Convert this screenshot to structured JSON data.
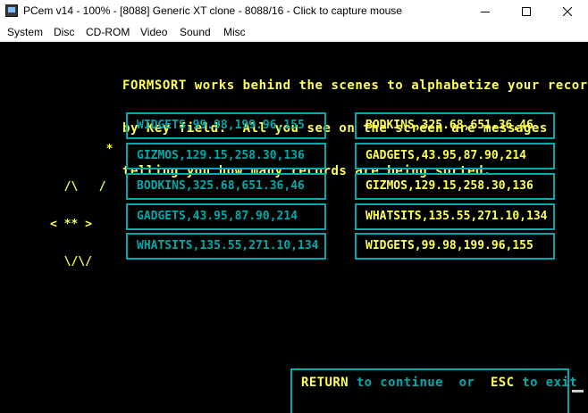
{
  "window": {
    "title": "PCem v14 - 100% - [8088] Generic XT clone - 8088/16 - Click to capture mouse",
    "icon": "pcem-app-icon",
    "controls": [
      "minimize-icon",
      "maximize-icon",
      "close-icon"
    ]
  },
  "menu": [
    "System",
    "Disc",
    "CD-ROM",
    "Video",
    "Sound",
    "Misc"
  ],
  "screen": {
    "intro": [
      "FORMSORT works behind the scenes to alphabetize your records",
      "by Key field.  All you see on the screen are messages",
      "telling you how many records are being sorted."
    ],
    "ascii_art": [
      "        *",
      "  /\\   /",
      "< ** >",
      "  \\/\\/"
    ],
    "unsorted_records": [
      "WIDGETS,99.98,199.96,155",
      "GIZMOS,129.15,258.30,136",
      "BODKINS,325.68,651.36,46",
      "GADGETS,43.95,87.90,214",
      "WHATSITS,135.55,271.10,134"
    ],
    "sorted_records": [
      "BODKINS,325.68,651.36,46",
      "GADGETS,43.95,87.90,214",
      "GIZMOS,129.15,258.30,136",
      "WHATSITS,135.55,271.10,134",
      "WIDGETS,99.98,199.96,155"
    ],
    "prompt": {
      "return_key": "RETURN",
      "continue_text": " to continue  ",
      "or_text": "or",
      "esc_key": "ESC",
      "exit_text": " to exit"
    }
  },
  "colors": {
    "yellow": "#ffff54",
    "cyan": "#00aaaa",
    "background": "#000000"
  }
}
